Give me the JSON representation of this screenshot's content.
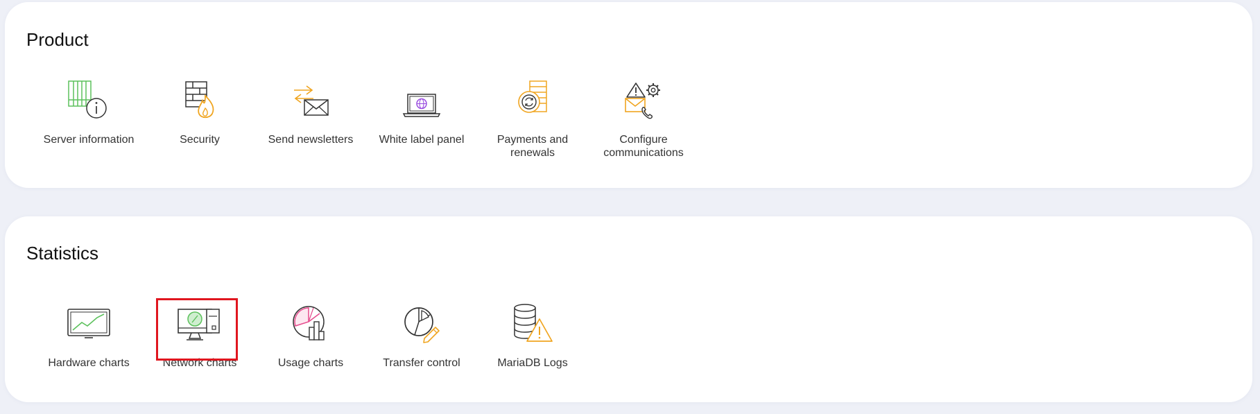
{
  "colors": {
    "page_background": "#eef0f7",
    "card_background": "#ffffff",
    "highlight_border": "#e0161f",
    "icon_green": "#5cc15c",
    "icon_orange": "#f0a520",
    "icon_purple": "#9b4fe0",
    "icon_pink": "#e64a8c"
  },
  "product": {
    "title": "Product",
    "items": [
      {
        "label": "Server information",
        "icon": "server-info-icon"
      },
      {
        "label": "Security",
        "icon": "firewall-icon"
      },
      {
        "label": "Send newsletters",
        "icon": "newsletter-icon"
      },
      {
        "label": "White label panel",
        "icon": "white-label-laptop-icon"
      },
      {
        "label": "Payments and renewals",
        "icon": "payments-renewals-icon"
      },
      {
        "label": "Configure communications",
        "icon": "communications-config-icon"
      }
    ]
  },
  "statistics": {
    "title": "Statistics",
    "items": [
      {
        "label": "Hardware charts",
        "icon": "hardware-chart-icon"
      },
      {
        "label": "Network charts",
        "icon": "network-chart-icon",
        "highlighted": true
      },
      {
        "label": "Usage charts",
        "icon": "usage-chart-icon"
      },
      {
        "label": "Transfer control",
        "icon": "transfer-control-icon"
      },
      {
        "label": "MariaDB Logs",
        "icon": "database-warning-icon"
      }
    ]
  }
}
